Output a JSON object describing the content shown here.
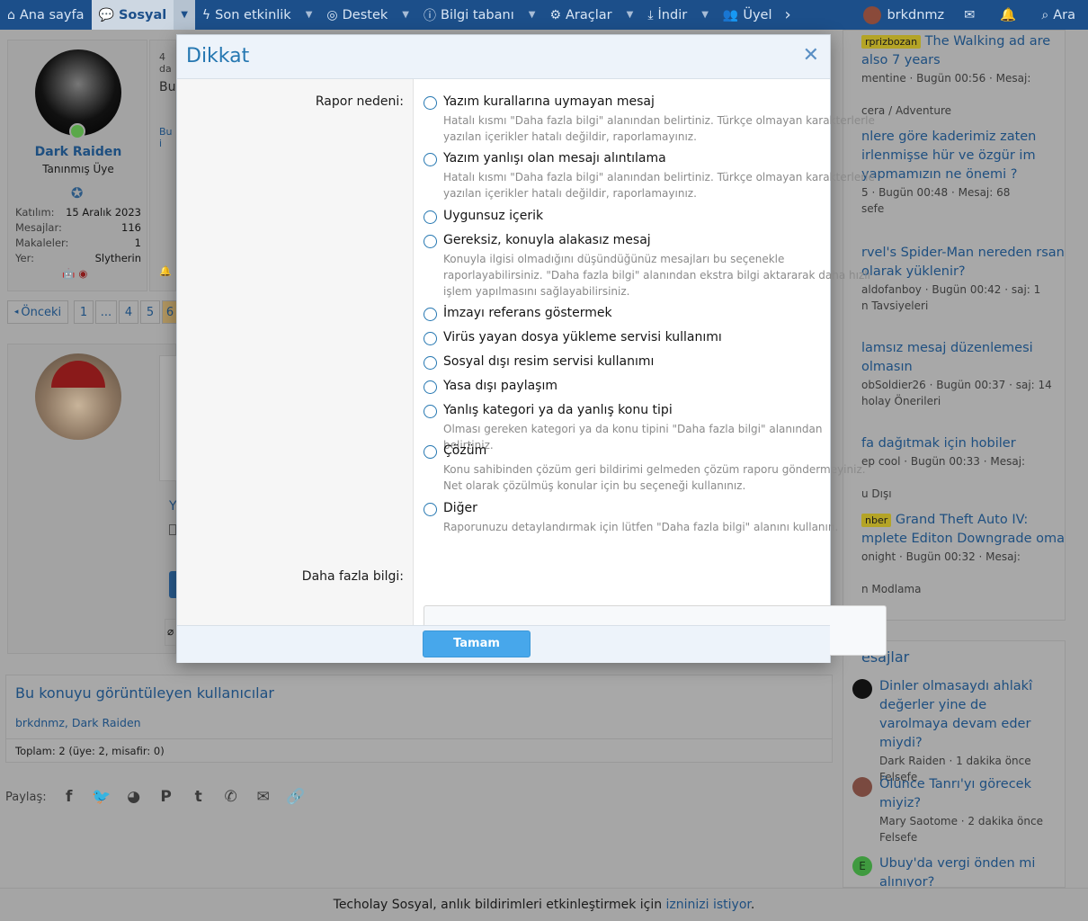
{
  "nav": {
    "items": [
      {
        "label": "Ana sayfa",
        "icon": "home-icon"
      },
      {
        "label": "Sosyal",
        "icon": "comments-icon"
      },
      {
        "label": "Son etkinlik",
        "icon": "bolt-icon"
      },
      {
        "label": "Destek",
        "icon": "support-icon"
      },
      {
        "label": "Bilgi tabanı",
        "icon": "info-icon"
      },
      {
        "label": "Araçlar",
        "icon": "gear-icon"
      },
      {
        "label": "İndir",
        "icon": "download-icon"
      },
      {
        "label": "Üyel",
        "icon": "users-icon"
      }
    ],
    "username": "brkdnmz",
    "search_label": "Ara"
  },
  "post": {
    "author": "Dark Raiden",
    "author_title": "Tanınmış Üye",
    "stats": [
      {
        "k": "Katılım:",
        "v": "15 Aralık 2023"
      },
      {
        "k": "Mesajlar:",
        "v": "116"
      },
      {
        "k": "Makaleler:",
        "v": "1"
      },
      {
        "k": "Yer:",
        "v": "Slytherin"
      }
    ],
    "frag_date": "4 da",
    "frag_text": "Bu",
    "frag_small": "Bu i"
  },
  "pagination": {
    "prev": "Önceki",
    "pages": [
      "1",
      "...",
      "4",
      "5",
      "6"
    ]
  },
  "viewers": {
    "title": "Bu konuyu görüntüleyen kullanıcılar",
    "names": "brkdnmz, Dark Raiden",
    "total": "Toplam: 2 (üye: 2, misafir: 0)"
  },
  "share": {
    "label": "Paylaş:"
  },
  "sidebar": {
    "threads": [
      {
        "tag": "rprizbozan",
        "title": "The Walking ad are also 7 years",
        "meta": "mentine · Bugün 00:56 · Mesaj:",
        "forum": "cera / Adventure"
      },
      {
        "tag": "",
        "title": "nlere göre kaderimiz zaten irlenmişse hür ve özgür im yapmamızın ne önemi ?",
        "meta": "5 · Bugün 00:48 · Mesaj: 68",
        "forum": "sefe"
      },
      {
        "tag": "",
        "title": "rvel's Spider-Man nereden rsan olarak yüklenir?",
        "meta": "aldofanboy · Bugün 00:42 · saj: 1",
        "forum": "n Tavsiyeleri"
      },
      {
        "tag": "",
        "title": "lamsız mesaj düzenlemesi olmasın",
        "meta": "obSoldier26 · Bugün 00:37 · saj: 14",
        "forum": "holay Önerileri"
      },
      {
        "tag": "",
        "title": "fa dağıtmak için hobiler",
        "meta": "ep cool · Bugün 00:33 · Mesaj:",
        "forum": "u Dışı"
      },
      {
        "tag": "nber",
        "title": "Grand Theft Auto IV: mplete Editon Downgrade oma",
        "meta": "onight · Bugün 00:32 · Mesaj:",
        "forum": "n Modlama"
      }
    ],
    "recent_title": "esajlar",
    "recent": [
      {
        "title": "Dinler olmasaydı ahlakî değerler yine de varolmaya devam eder miydi?",
        "meta": "Dark Raiden · 1 dakika önce",
        "forum": "Felsefe"
      },
      {
        "title": "Ölünce Tanrı'yı görecek miyiz?",
        "meta": "Mary Saotome · 2 dakika önce",
        "forum": "Felsefe"
      },
      {
        "title": "Ubuy'da vergi önden mi alınıyor?",
        "meta": "",
        "forum": ""
      }
    ]
  },
  "notice": {
    "text": "Techolay Sosyal, anlık bildirimleri etkinleştirmek için ",
    "link": "izninizi istiyor",
    "end": "."
  },
  "modal": {
    "title": "Dikkat",
    "reason_label": "Rapor nedeni:",
    "more_label": "Daha fazla bilgi:",
    "ok_label": "Tamam",
    "options": [
      {
        "label": "Yazım kurallarına uymayan mesaj",
        "hint": "Hatalı kısmı \"Daha fazla bilgi\" alanından belirtiniz. Türkçe olmayan karakterlerle yazılan içerikler hatalı değildir, raporlamayınız."
      },
      {
        "label": "Yazım yanlışı olan mesajı alıntılama",
        "hint": "Hatalı kısmı \"Daha fazla bilgi\" alanından belirtiniz. Türkçe olmayan karakterlerle yazılan içerikler hatalı değildir, raporlamayınız."
      },
      {
        "label": "Uygunsuz içerik",
        "hint": ""
      },
      {
        "label": "Gereksiz, konuyla alakasız mesaj",
        "hint": "Konuyla ilgisi olmadığını düşündüğünüz mesajları bu seçenekle raporlayabilirsiniz. \"Daha fazla bilgi\" alanından ekstra bilgi aktararak daha hızlı işlem yapılmasını sağlayabilirsiniz."
      },
      {
        "label": "İmzayı referans göstermek",
        "hint": ""
      },
      {
        "label": "Virüs yayan dosya yükleme servisi kullanımı",
        "hint": ""
      },
      {
        "label": "Sosyal dışı resim servisi kullanımı",
        "hint": ""
      },
      {
        "label": "Yasa dışı paylaşım",
        "hint": ""
      },
      {
        "label": "Yanlış kategori ya da yanlış konu tipi",
        "hint": "Olması gereken kategori ya da konu tipini \"Daha fazla bilgi\" alanından belirtiniz."
      },
      {
        "label": "Çözüm",
        "hint": "Konu sahibinden çözüm geri bildirimi gelmeden çözüm raporu göndermeyiniz. Net olarak çözülmüş konular için bu seçeneği kullanınız."
      },
      {
        "label": "Diğer",
        "hint": "Raporunuzu detaylandırmak için lütfen \"Daha fazla bilgi\" alanını kullanın."
      }
    ]
  }
}
